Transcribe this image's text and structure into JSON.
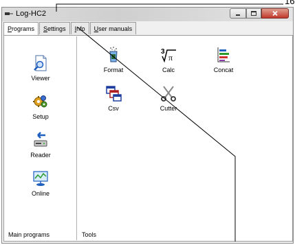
{
  "window": {
    "title": "Log-HC2"
  },
  "tabs": [
    {
      "label": "Programs",
      "hotkey": "P",
      "rest": "rograms"
    },
    {
      "label": "Settings",
      "hotkey": "S",
      "rest": "ettings"
    },
    {
      "label": "Info",
      "hotkey": "I",
      "rest": "nfo"
    },
    {
      "label": "User manuals",
      "hotkey": "U",
      "rest": "ser manuals"
    }
  ],
  "main_programs": {
    "section_label": "Main programs",
    "items": [
      {
        "label": "Viewer",
        "icon": "viewer-icon"
      },
      {
        "label": "Setup",
        "icon": "setup-icon"
      },
      {
        "label": "Reader",
        "icon": "reader-icon"
      },
      {
        "label": "Online",
        "icon": "online-icon"
      }
    ]
  },
  "tools": {
    "section_label": "Tools",
    "items": [
      {
        "label": "Format",
        "icon": "format-icon"
      },
      {
        "label": "Calc",
        "icon": "calc-icon"
      },
      {
        "label": "Concat",
        "icon": "concat-icon"
      },
      {
        "label": "Csv",
        "icon": "csv-icon"
      },
      {
        "label": "Cutter",
        "icon": "cutter-icon"
      }
    ]
  },
  "callout": {
    "text": "16"
  }
}
